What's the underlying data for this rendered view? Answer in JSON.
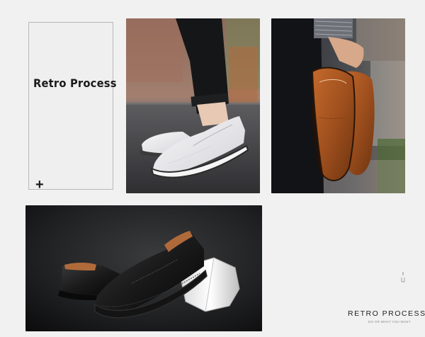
{
  "label_card": {
    "title": "Retro Process",
    "plus": "+"
  },
  "caption": {
    "title": "RETRO PROCESS",
    "subtitle": "DO OR WHAT YOU WANT"
  },
  "photos": [
    {
      "name": "white-shoe-photo",
      "subject": "white slip-on leather loafer on asphalt"
    },
    {
      "name": "brown-shoe-photo",
      "subject": "hand holding brown leather loafers"
    },
    {
      "name": "black-shoe-photo",
      "subject": "black leather loafers with white octagon block"
    }
  ],
  "colors": {
    "background": "#f1f1f1",
    "label_border": "#b8b8b8",
    "brown_leather": "#a0501e",
    "black_leather": "#1a1a1a",
    "white_leather": "#e9e9ec"
  }
}
